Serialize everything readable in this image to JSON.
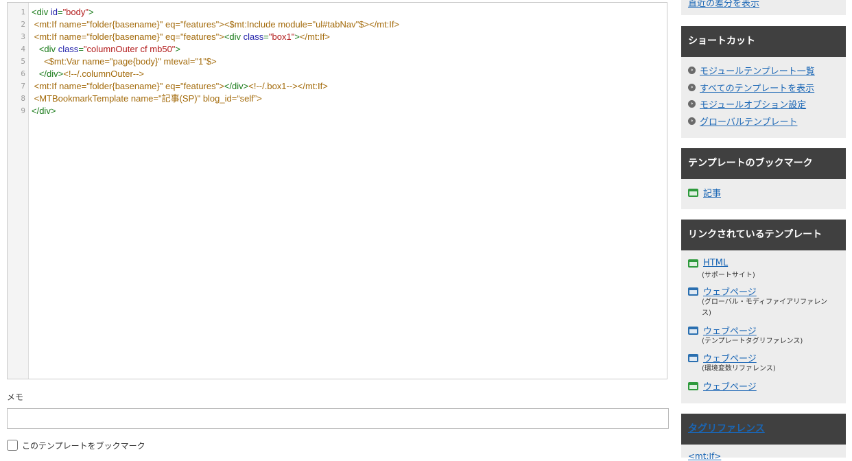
{
  "editor": {
    "line_numbers": [
      "1",
      "2",
      "3",
      "4",
      "5",
      "6",
      "7",
      "8",
      "9"
    ]
  },
  "memo": {
    "label": "メモ",
    "value": ""
  },
  "bookmark": {
    "label": "このテンプレートをブックマーク",
    "checked": false
  },
  "sidebar": {
    "top_link": "直近の差分を表示",
    "shortcut": {
      "title": "ショートカット",
      "items": [
        "モジュールテンプレート一覧",
        "すべてのテンプレートを表示",
        "モジュールオプション設定",
        "グローバルテンプレート"
      ]
    },
    "bookmarks": {
      "title": "テンプレートのブックマーク",
      "items": [
        {
          "label": "記事",
          "icon": "template-icon"
        }
      ]
    },
    "linked": {
      "title": "リンクされているテンプレート",
      "items": [
        {
          "label": "HTML",
          "sub": "(サポートサイト)",
          "icon": "template-green-icon"
        },
        {
          "label": "ウェブページ",
          "sub": "(グローバル・モディファイアリファレンス)",
          "icon": "template-blue-icon"
        },
        {
          "label": "ウェブページ",
          "sub": "(テンプレートタグリファレンス)",
          "icon": "template-blue-icon"
        },
        {
          "label": "ウェブページ",
          "sub": "(環境変数リファレンス)",
          "icon": "template-blue-icon"
        },
        {
          "label": "ウェブページ",
          "sub": "",
          "icon": "template-green-icon"
        }
      ]
    },
    "tag_ref": {
      "title": "タグリファレンス",
      "first_item": "<mt:If>"
    }
  },
  "colors": {
    "panel_head": "#404040",
    "link": "#1a66b5",
    "panel_bg": "#ededed"
  }
}
